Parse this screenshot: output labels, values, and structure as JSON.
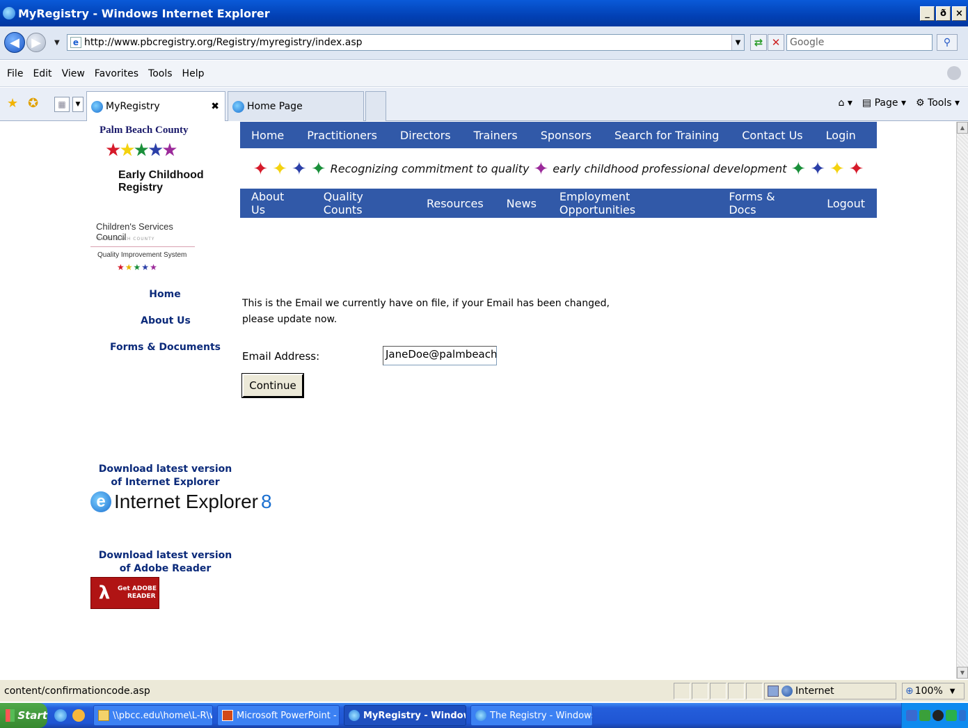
{
  "window": {
    "title": "MyRegistry - Windows Internet Explorer",
    "minimize": "_",
    "restore": "ð",
    "close": "×"
  },
  "address_bar": {
    "url": "http://www.pbcregistry.org/Registry/myregistry/index.asp",
    "search_placeholder": "Google"
  },
  "menu": [
    "File",
    "Edit",
    "View",
    "Favorites",
    "Tools",
    "Help"
  ],
  "tabs": [
    {
      "label": "MyRegistry",
      "active": true
    },
    {
      "label": "Home Page",
      "active": false
    }
  ],
  "command_bar": {
    "page": "Page",
    "tools": "Tools"
  },
  "site": {
    "logo_arc": "Palm Beach County",
    "logo_name": "Early Childhood Registry",
    "csc_name": "Children's Services Council",
    "csc_sub": "PALM BEACH COUNTY",
    "csc_qis": "Quality Improvement System",
    "top_nav": [
      "Home",
      "Practitioners",
      "Directors",
      "Trainers",
      "Sponsors",
      "Search for Training",
      "Contact Us",
      "Login"
    ],
    "tagline_left": "Recognizing commitment to quality",
    "tagline_right": "early childhood professional development",
    "sub_nav": [
      "About Us",
      "Quality Counts",
      "Resources",
      "News",
      "Employment Opportunities",
      "Forms & Docs",
      "Logout"
    ],
    "side_links": [
      "Home",
      "About Us",
      "Forms & Documents"
    ],
    "download_ie": "Download latest version of Internet Explorer",
    "ie_logo": "Internet Explorer",
    "ie_version": "8",
    "download_adobe": "Download latest version of Adobe Reader",
    "adobe_badge_line1": "Get ADOBE",
    "adobe_badge_line2": "READER"
  },
  "form": {
    "message": "This is the Email we currently have on file, if your Email has been changed, please update now.",
    "email_label": "Email Address:",
    "email_value": "JaneDoe@palmbeachs",
    "continue_label": "Continue"
  },
  "status_bar": {
    "text": "content/confirmationcode.asp",
    "zone": "Internet",
    "zoom": "100%"
  },
  "taskbar": {
    "start": "Start",
    "tasks": [
      {
        "label": "\\\\pbcc.edu\\home\\L-R\\we..."
      },
      {
        "label": "Microsoft PowerPoint - [..."
      },
      {
        "label": "MyRegistry - Window..."
      },
      {
        "label": "The Registry - Windows ..."
      }
    ]
  },
  "colors": {
    "nav_blue": "#3159a8",
    "link_navy": "#0b2a7a",
    "titlebar": "#0a5ad8"
  }
}
